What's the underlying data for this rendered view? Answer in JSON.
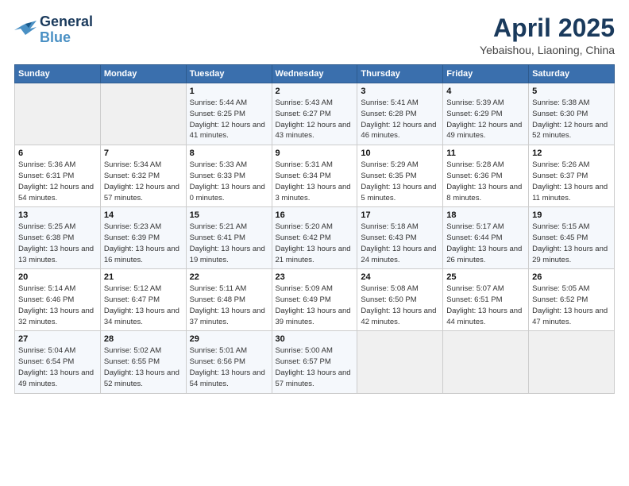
{
  "logo": {
    "line1": "General",
    "line2": "Blue"
  },
  "title": "April 2025",
  "subtitle": "Yebaishou, Liaoning, China",
  "weekdays": [
    "Sunday",
    "Monday",
    "Tuesday",
    "Wednesday",
    "Thursday",
    "Friday",
    "Saturday"
  ],
  "weeks": [
    [
      {
        "day": "",
        "sunrise": "",
        "sunset": "",
        "daylight": ""
      },
      {
        "day": "",
        "sunrise": "",
        "sunset": "",
        "daylight": ""
      },
      {
        "day": "1",
        "sunrise": "Sunrise: 5:44 AM",
        "sunset": "Sunset: 6:25 PM",
        "daylight": "Daylight: 12 hours and 41 minutes."
      },
      {
        "day": "2",
        "sunrise": "Sunrise: 5:43 AM",
        "sunset": "Sunset: 6:27 PM",
        "daylight": "Daylight: 12 hours and 43 minutes."
      },
      {
        "day": "3",
        "sunrise": "Sunrise: 5:41 AM",
        "sunset": "Sunset: 6:28 PM",
        "daylight": "Daylight: 12 hours and 46 minutes."
      },
      {
        "day": "4",
        "sunrise": "Sunrise: 5:39 AM",
        "sunset": "Sunset: 6:29 PM",
        "daylight": "Daylight: 12 hours and 49 minutes."
      },
      {
        "day": "5",
        "sunrise": "Sunrise: 5:38 AM",
        "sunset": "Sunset: 6:30 PM",
        "daylight": "Daylight: 12 hours and 52 minutes."
      }
    ],
    [
      {
        "day": "6",
        "sunrise": "Sunrise: 5:36 AM",
        "sunset": "Sunset: 6:31 PM",
        "daylight": "Daylight: 12 hours and 54 minutes."
      },
      {
        "day": "7",
        "sunrise": "Sunrise: 5:34 AM",
        "sunset": "Sunset: 6:32 PM",
        "daylight": "Daylight: 12 hours and 57 minutes."
      },
      {
        "day": "8",
        "sunrise": "Sunrise: 5:33 AM",
        "sunset": "Sunset: 6:33 PM",
        "daylight": "Daylight: 13 hours and 0 minutes."
      },
      {
        "day": "9",
        "sunrise": "Sunrise: 5:31 AM",
        "sunset": "Sunset: 6:34 PM",
        "daylight": "Daylight: 13 hours and 3 minutes."
      },
      {
        "day": "10",
        "sunrise": "Sunrise: 5:29 AM",
        "sunset": "Sunset: 6:35 PM",
        "daylight": "Daylight: 13 hours and 5 minutes."
      },
      {
        "day": "11",
        "sunrise": "Sunrise: 5:28 AM",
        "sunset": "Sunset: 6:36 PM",
        "daylight": "Daylight: 13 hours and 8 minutes."
      },
      {
        "day": "12",
        "sunrise": "Sunrise: 5:26 AM",
        "sunset": "Sunset: 6:37 PM",
        "daylight": "Daylight: 13 hours and 11 minutes."
      }
    ],
    [
      {
        "day": "13",
        "sunrise": "Sunrise: 5:25 AM",
        "sunset": "Sunset: 6:38 PM",
        "daylight": "Daylight: 13 hours and 13 minutes."
      },
      {
        "day": "14",
        "sunrise": "Sunrise: 5:23 AM",
        "sunset": "Sunset: 6:39 PM",
        "daylight": "Daylight: 13 hours and 16 minutes."
      },
      {
        "day": "15",
        "sunrise": "Sunrise: 5:21 AM",
        "sunset": "Sunset: 6:41 PM",
        "daylight": "Daylight: 13 hours and 19 minutes."
      },
      {
        "day": "16",
        "sunrise": "Sunrise: 5:20 AM",
        "sunset": "Sunset: 6:42 PM",
        "daylight": "Daylight: 13 hours and 21 minutes."
      },
      {
        "day": "17",
        "sunrise": "Sunrise: 5:18 AM",
        "sunset": "Sunset: 6:43 PM",
        "daylight": "Daylight: 13 hours and 24 minutes."
      },
      {
        "day": "18",
        "sunrise": "Sunrise: 5:17 AM",
        "sunset": "Sunset: 6:44 PM",
        "daylight": "Daylight: 13 hours and 26 minutes."
      },
      {
        "day": "19",
        "sunrise": "Sunrise: 5:15 AM",
        "sunset": "Sunset: 6:45 PM",
        "daylight": "Daylight: 13 hours and 29 minutes."
      }
    ],
    [
      {
        "day": "20",
        "sunrise": "Sunrise: 5:14 AM",
        "sunset": "Sunset: 6:46 PM",
        "daylight": "Daylight: 13 hours and 32 minutes."
      },
      {
        "day": "21",
        "sunrise": "Sunrise: 5:12 AM",
        "sunset": "Sunset: 6:47 PM",
        "daylight": "Daylight: 13 hours and 34 minutes."
      },
      {
        "day": "22",
        "sunrise": "Sunrise: 5:11 AM",
        "sunset": "Sunset: 6:48 PM",
        "daylight": "Daylight: 13 hours and 37 minutes."
      },
      {
        "day": "23",
        "sunrise": "Sunrise: 5:09 AM",
        "sunset": "Sunset: 6:49 PM",
        "daylight": "Daylight: 13 hours and 39 minutes."
      },
      {
        "day": "24",
        "sunrise": "Sunrise: 5:08 AM",
        "sunset": "Sunset: 6:50 PM",
        "daylight": "Daylight: 13 hours and 42 minutes."
      },
      {
        "day": "25",
        "sunrise": "Sunrise: 5:07 AM",
        "sunset": "Sunset: 6:51 PM",
        "daylight": "Daylight: 13 hours and 44 minutes."
      },
      {
        "day": "26",
        "sunrise": "Sunrise: 5:05 AM",
        "sunset": "Sunset: 6:52 PM",
        "daylight": "Daylight: 13 hours and 47 minutes."
      }
    ],
    [
      {
        "day": "27",
        "sunrise": "Sunrise: 5:04 AM",
        "sunset": "Sunset: 6:54 PM",
        "daylight": "Daylight: 13 hours and 49 minutes."
      },
      {
        "day": "28",
        "sunrise": "Sunrise: 5:02 AM",
        "sunset": "Sunset: 6:55 PM",
        "daylight": "Daylight: 13 hours and 52 minutes."
      },
      {
        "day": "29",
        "sunrise": "Sunrise: 5:01 AM",
        "sunset": "Sunset: 6:56 PM",
        "daylight": "Daylight: 13 hours and 54 minutes."
      },
      {
        "day": "30",
        "sunrise": "Sunrise: 5:00 AM",
        "sunset": "Sunset: 6:57 PM",
        "daylight": "Daylight: 13 hours and 57 minutes."
      },
      {
        "day": "",
        "sunrise": "",
        "sunset": "",
        "daylight": ""
      },
      {
        "day": "",
        "sunrise": "",
        "sunset": "",
        "daylight": ""
      },
      {
        "day": "",
        "sunrise": "",
        "sunset": "",
        "daylight": ""
      }
    ]
  ]
}
